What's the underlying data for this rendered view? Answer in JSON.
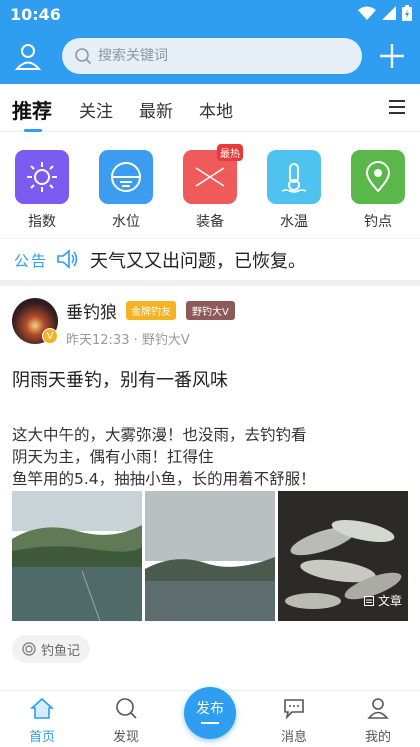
{
  "status": {
    "time": "10:46"
  },
  "header": {
    "search_placeholder": "搜索关键词",
    "profile_icon": "user-icon",
    "add_icon": "plus-icon"
  },
  "tabs": [
    {
      "label": "推荐",
      "active": true
    },
    {
      "label": "关注"
    },
    {
      "label": "最新"
    },
    {
      "label": "本地"
    }
  ],
  "quick_actions": [
    {
      "label": "指数",
      "icon": "sun-icon",
      "color": "#7b5cf0"
    },
    {
      "label": "水位",
      "icon": "water-level-icon",
      "color": "#3b9cf0"
    },
    {
      "label": "装备",
      "icon": "gear-cross-icon",
      "color": "#f05a5a",
      "badge": "最热"
    },
    {
      "label": "水温",
      "icon": "thermometer-icon",
      "color": "#4ec3ef"
    },
    {
      "label": "钓点",
      "icon": "map-pin-icon",
      "color": "#5ab84a"
    }
  ],
  "notice": {
    "tag": "公告",
    "message": "天气又又出问题，已恢复。"
  },
  "post": {
    "author": "垂钓狼",
    "badge_gold": "金牌钓友",
    "badge_wild": "野钓大V",
    "avatar_badge": "V",
    "meta": "昨天12:33 · 野钓大V",
    "title": "阴雨天垂钓，别有一番风味",
    "body_lines": [
      "这大中午的，大雾弥漫！也没雨，去钓钓看",
      "阴天为主，偶有小雨！扛得住",
      "鱼竿用的5.4，抽抽小鱼，长的用着不舒服！"
    ],
    "image_label": "文章",
    "category": "钓鱼记"
  },
  "bottom_nav": [
    {
      "label": "首页",
      "icon": "home-icon",
      "active": true
    },
    {
      "label": "发现",
      "icon": "discover-icon"
    },
    {
      "label": "发布",
      "icon": "publish-icon"
    },
    {
      "label": "消息",
      "icon": "message-icon"
    },
    {
      "label": "我的",
      "icon": "profile-icon"
    }
  ],
  "colors": {
    "primary": "#2f9df0",
    "hot_badge": "#e83a3a",
    "gold": "#f5b323"
  }
}
